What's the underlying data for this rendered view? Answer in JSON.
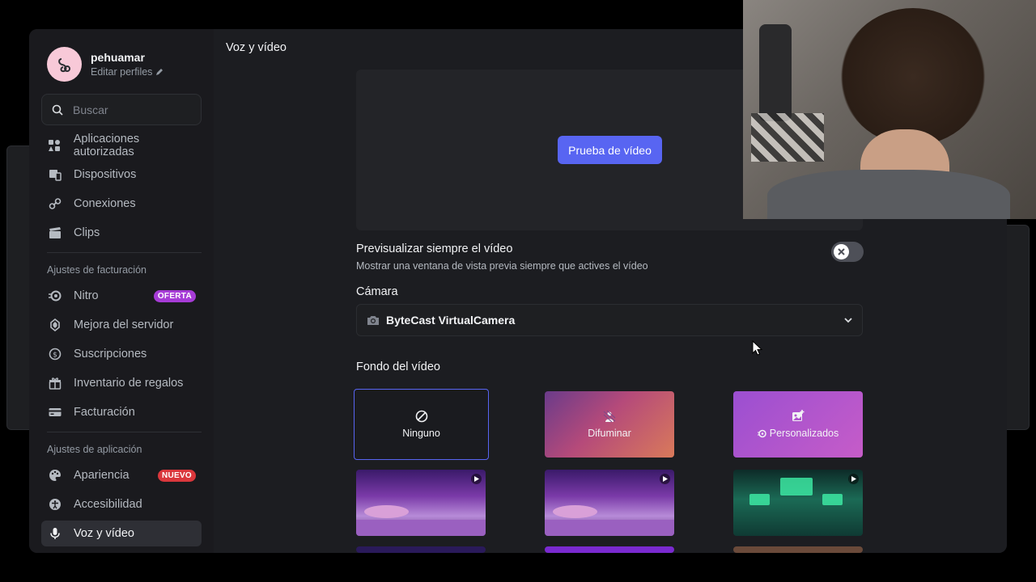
{
  "profile": {
    "username": "pehuamar",
    "edit_label": "Editar perfiles"
  },
  "search": {
    "placeholder": "Buscar"
  },
  "sidebar": {
    "items_top": [
      {
        "label": "Aplicaciones autorizadas",
        "icon": "puzzle-icon"
      },
      {
        "label": "Dispositivos",
        "icon": "devices-icon"
      },
      {
        "label": "Conexiones",
        "icon": "link-icon"
      },
      {
        "label": "Clips",
        "icon": "clapper-icon"
      }
    ],
    "billing_section": "Ajustes de facturación",
    "billing_items": [
      {
        "label": "Nitro",
        "icon": "nitro-icon",
        "badge": "OFERTA"
      },
      {
        "label": "Mejora del servidor",
        "icon": "boost-icon"
      },
      {
        "label": "Suscripciones",
        "icon": "subscriptions-icon"
      },
      {
        "label": "Inventario de regalos",
        "icon": "gift-icon"
      },
      {
        "label": "Facturación",
        "icon": "card-icon"
      }
    ],
    "app_section": "Ajustes de aplicación",
    "app_items": [
      {
        "label": "Apariencia",
        "icon": "palette-icon",
        "badge": "NUEVO"
      },
      {
        "label": "Accesibilidad",
        "icon": "accessibility-icon"
      },
      {
        "label": "Voz y vídeo",
        "icon": "mic-icon"
      }
    ]
  },
  "colors": {
    "accent": "#5865f2",
    "offer_badge": "#a63bd6",
    "new_badge": "#da373c"
  },
  "main": {
    "title": "Voz y vídeo",
    "test_video_button": "Prueba de vídeo",
    "always_preview": {
      "title": "Previsualizar siempre el vídeo",
      "description": "Mostrar una ventana de vista previa siempre que actives el vídeo",
      "enabled": false
    },
    "camera": {
      "label": "Cámara",
      "selected": "ByteCast VirtualCamera"
    },
    "background": {
      "label": "Fondo del vídeo",
      "options": [
        {
          "label": "Ninguno",
          "icon": "none-icon",
          "selected": true
        },
        {
          "label": "Difuminar",
          "icon": "blur-icon"
        },
        {
          "label": "Personalizados",
          "icon": "add-image-icon"
        }
      ]
    }
  }
}
